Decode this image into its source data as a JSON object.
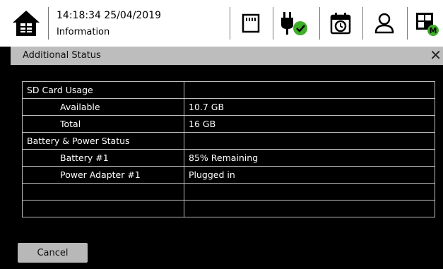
{
  "topbar": {
    "clock": "14:18:34  25/04/2019",
    "page": "Information"
  },
  "icons": {
    "home": "home-icon",
    "sd_card": "sd-card-icon",
    "power": "power-plug-check-icon",
    "calendar": "calendar-clock-icon",
    "user": "user-icon",
    "layout": "layout-m-icon"
  },
  "colors": {
    "accent_green": "#3fae29",
    "header_bg": "#bdbdbd"
  },
  "dialog": {
    "title": "Additional Status",
    "close_symbol": "✕",
    "cancel_label": "Cancel"
  },
  "table": {
    "rows": [
      {
        "label": "SD Card Usage",
        "value": ""
      },
      {
        "label": "Available",
        "value": "10.7 GB"
      },
      {
        "label": "Total",
        "value": "16 GB"
      },
      {
        "label": "Battery & Power Status",
        "value": ""
      },
      {
        "label": "Battery #1",
        "value": "85% Remaining"
      },
      {
        "label": "Power Adapter #1",
        "value": "Plugged in"
      },
      {
        "label": "",
        "value": ""
      },
      {
        "label": "",
        "value": ""
      }
    ]
  }
}
